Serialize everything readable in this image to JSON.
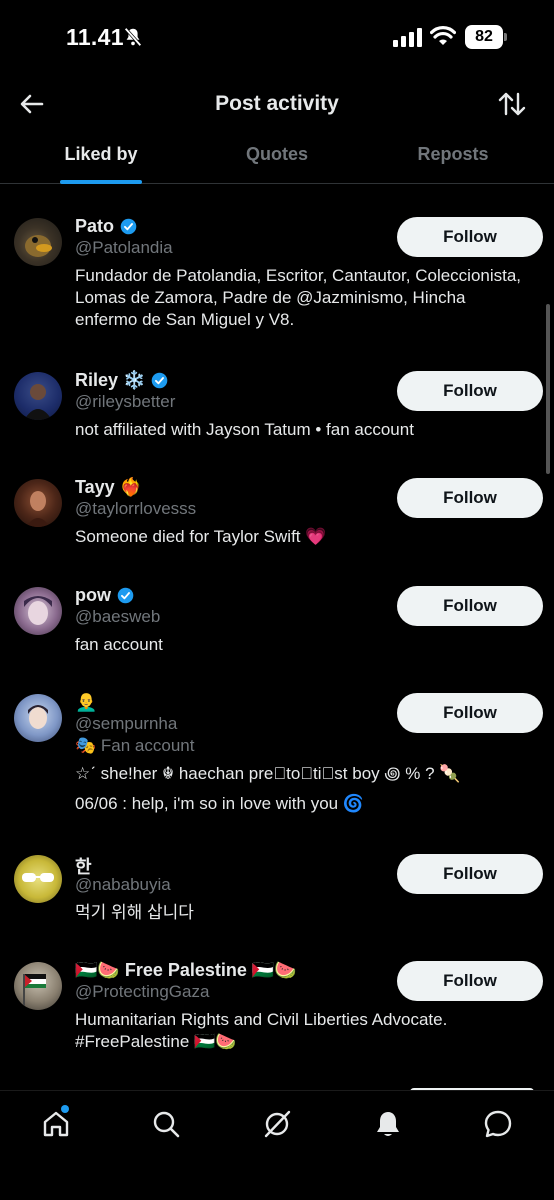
{
  "status_bar": {
    "time": "11.41",
    "battery": "82"
  },
  "header": {
    "title": "Post activity"
  },
  "tabs": [
    {
      "label": "Liked by",
      "active": true
    },
    {
      "label": "Quotes",
      "active": false
    },
    {
      "label": "Reposts",
      "active": false
    }
  ],
  "users": [
    {
      "name": "Pato",
      "handle": "@Patolandia",
      "verified": true,
      "bio": "Fundador de Patolandia, Escritor, Cantautor, Coleccionista, Lomas de Zamora, Padre de @Jazminismo, Hincha enfermo de San Miguel y V8.",
      "follow_label": "Follow"
    },
    {
      "name": "Riley ❄️",
      "handle": "@rileysbetter",
      "verified": true,
      "bio": "not affiliated with Jayson Tatum • fan account",
      "follow_label": "Follow"
    },
    {
      "name": "Tayy ❤️‍🔥",
      "handle": "@taylorrlovesss",
      "verified": false,
      "bio": "Someone died for Taylor Swift 💗",
      "follow_label": "Follow"
    },
    {
      "name": "pow",
      "handle": "@baesweb",
      "verified": true,
      "bio": "fan account",
      "follow_label": "Follow"
    },
    {
      "name": "👨‍🦲",
      "handle": "@sempurnha",
      "verified": false,
      "label": "🎭 Fan account",
      "bio": "☆ˊ she!her ☬ haechan pre⃝to⃝ti⃝st boy ꩜ % ? 🍡",
      "bio2": "06/06 : help, i'm so in love with you 🌀",
      "follow_label": "Follow"
    },
    {
      "name": "한",
      "handle": "@nababuyia",
      "verified": false,
      "bio": "먹기 위해 삽니다",
      "follow_label": "Follow"
    },
    {
      "name": "🇵🇸🍉 Free Palestine 🇵🇸🍉",
      "handle": "@ProtectingGaza",
      "verified": false,
      "bio": "Humanitarian Rights and Civil Liberties Advocate. #FreePalestine 🇵🇸🍉",
      "follow_label": "Follow"
    }
  ],
  "nav": [
    {
      "icon": "home-icon"
    },
    {
      "icon": "search-icon"
    },
    {
      "icon": "grok-icon"
    },
    {
      "icon": "notifications-icon"
    },
    {
      "icon": "messages-icon"
    }
  ],
  "colors": {
    "accent": "#1d9bf0",
    "background": "#000000",
    "secondary_text": "#71767b",
    "follow_bg": "#eff3f4"
  }
}
